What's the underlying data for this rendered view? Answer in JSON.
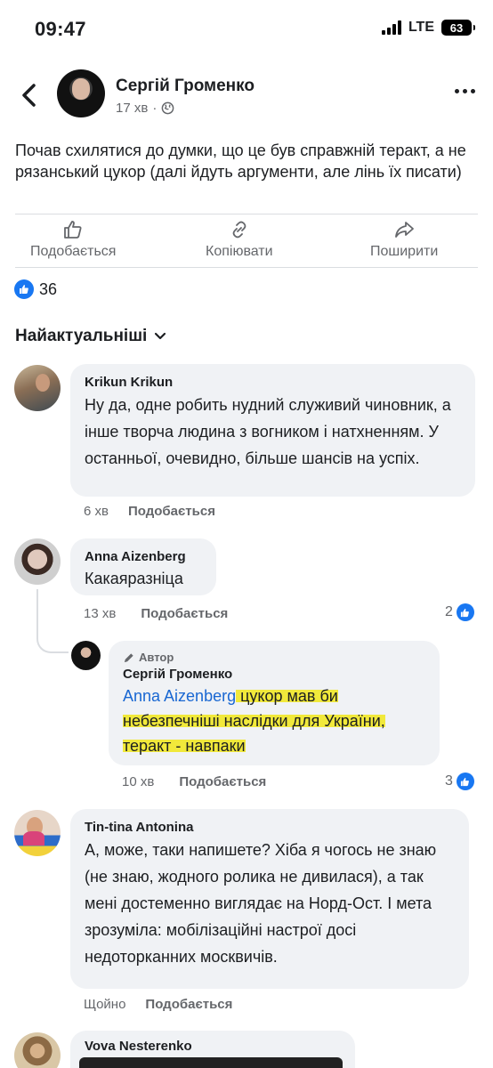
{
  "status_bar": {
    "time": "09:47",
    "network": "LTE",
    "battery": "63"
  },
  "post": {
    "author": "Сергій Громенко",
    "time": "17 хв",
    "text": "Почав схилятися до думки, що це був справжній теракт, а не рязанський цукор (далі йдуть аргументи, але лінь їх писати)",
    "actions": {
      "like": "Подобається",
      "copy": "Копіювати",
      "share": "Поширити"
    },
    "reaction_count": "36"
  },
  "sort_label": "Найактуальніші",
  "comments": [
    {
      "name": "Krikun Krikun",
      "text": "Ну да, одне робить нудний служивий чиновник, а інше творча людина з вогником і натхненням. У останньої, очевидно, більше шансів на успіх.",
      "time": "6 хв",
      "like": "Подобається"
    },
    {
      "name": "Anna Aizenberg",
      "text": "Какаяразніца",
      "time": "13 хв",
      "like": "Подобається",
      "reactions": "2"
    },
    {
      "badge": "Автор",
      "name": "Сергій Громенко",
      "mention": "Anna Aizenberg",
      "text_rest": " цукор мав би небезпечніші наслідки для України, теракт - навпаки",
      "time": "10 хв",
      "like": "Подобається",
      "reactions": "3"
    },
    {
      "name": "Tin-tina Antonina",
      "text": "А, може, таки напишете? Хіба я чогось не знаю (не знаю, жодного ролика не дивилася), а так мені достеменно виглядає на Норд-Ост. І мета зрозуміла: мобілізаційні настрої досі недоторканних москвичів.",
      "time": "Щойно",
      "like": "Подобається"
    },
    {
      "name": "Vova Nesterenko"
    }
  ],
  "colors": {
    "accent": "#1877f2",
    "bubble": "#f0f2f5",
    "secondary_text": "#65676b",
    "highlight": "#f1e93b"
  }
}
